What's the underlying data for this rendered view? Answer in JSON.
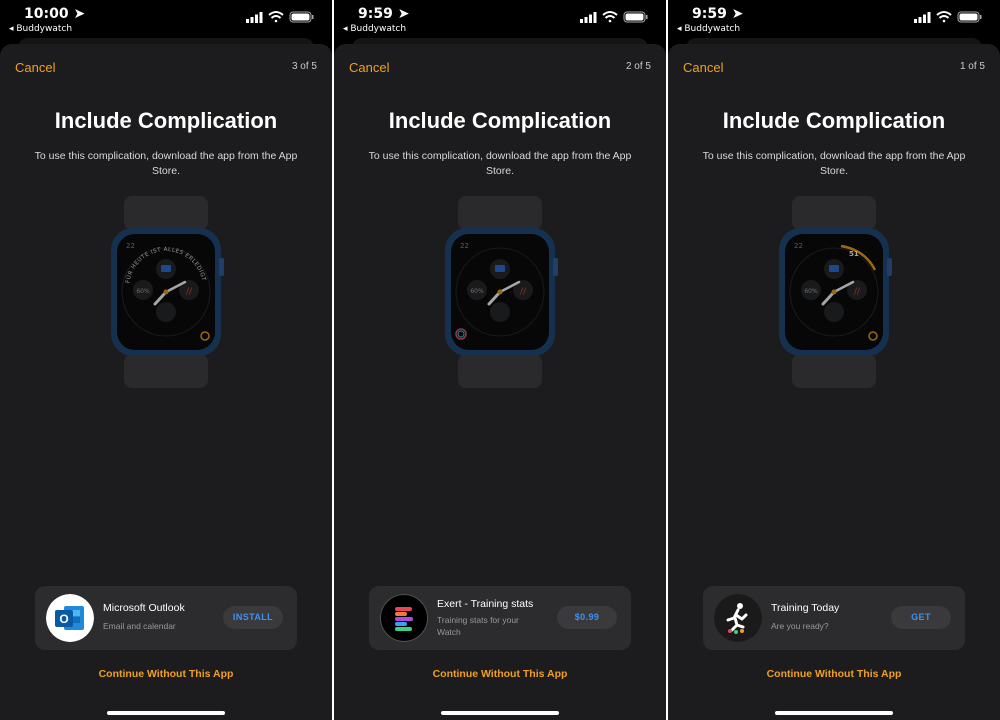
{
  "screens": [
    {
      "status": {
        "time": "10:00 ➤",
        "back": "◂ Buddywatch"
      },
      "header": {
        "cancel": "Cancel",
        "step": "3 of 5"
      },
      "title": "Include Complication",
      "description": "To use this complication, download the app from the App Store.",
      "app": {
        "name": "Microsoft Outlook",
        "subtitle": "Email and calendar",
        "button": "INSTALL",
        "icon": "outlook-icon"
      },
      "continue": "Continue Without This App",
      "watch_complication_text": "FÜR HEUTE IST ALLES ERLEDIGT"
    },
    {
      "status": {
        "time": "9:59 ➤",
        "back": "◂ Buddywatch"
      },
      "header": {
        "cancel": "Cancel",
        "step": "2 of 5"
      },
      "title": "Include Complication",
      "description": "To use this complication, download the app from the App Store.",
      "app": {
        "name": "Exert - Training stats",
        "subtitle": "Training stats for your Watch",
        "button": "$0.99",
        "icon": "exert-icon"
      },
      "continue": "Continue Without This App"
    },
    {
      "status": {
        "time": "9:59 ➤",
        "back": "◂ Buddywatch"
      },
      "header": {
        "cancel": "Cancel",
        "step": "1 of 5"
      },
      "title": "Include Complication",
      "description": "To use this complication, download the app from the App Store.",
      "app": {
        "name": "Training Today",
        "subtitle": "Are you ready?",
        "button": "GET",
        "icon": "runner-icon"
      },
      "continue": "Continue Without This App",
      "watch_complication_text": "51"
    }
  ],
  "watch": {
    "date_text": "22",
    "ring_text": "60%"
  },
  "colors": {
    "accent": "#f0a01c",
    "link_blue": "#3b93f5",
    "sheet": "#1c1c1e",
    "card": "#2c2c2e"
  }
}
